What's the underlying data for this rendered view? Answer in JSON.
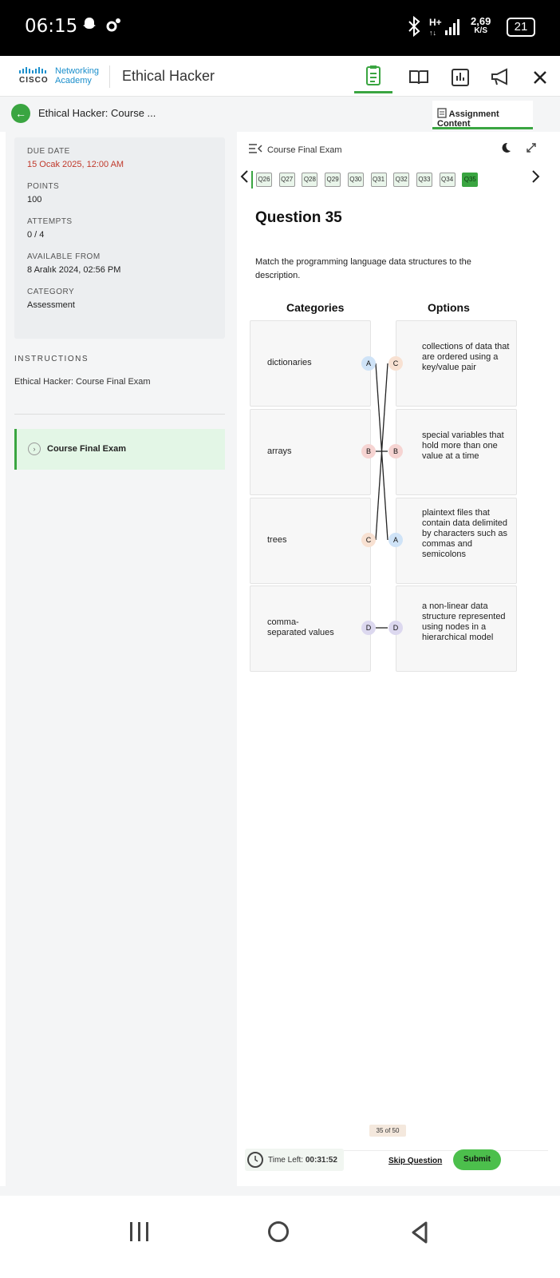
{
  "status_bar": {
    "time": "06:15",
    "speed_value": "2,69",
    "speed_unit": "K/S",
    "battery": "21",
    "icons": [
      "snapchat-ghost-icon",
      "settings-icon",
      "bluetooth-icon",
      "signal-icon",
      "battery-icon"
    ]
  },
  "header": {
    "logo_networking": "Networking",
    "logo_academy": "Academy",
    "logo_cisco": "CISCO",
    "app_title": "Ethical Hacker",
    "icons": [
      "assignment-icon",
      "book-icon",
      "gradebook-icon",
      "megaphone-icon",
      "close-icon"
    ]
  },
  "course_bar": {
    "title": "Ethical Hacker: Course ...",
    "assignment_tab": "Assignment Content"
  },
  "meta": {
    "due_date_label": "DUE DATE",
    "due_date_value": "15 Ocak 2025, 12:00 AM",
    "points_label": "POINTS",
    "points_value": "100",
    "attempts_label": "ATTEMPTS",
    "attempts_value": "0 / 4",
    "available_label": "AVAILABLE FROM",
    "available_value": "8 Aralık 2024, 02:56 PM",
    "category_label": "CATEGORY",
    "category_value": "Assessment"
  },
  "instructions": {
    "label": "INSTRUCTIONS",
    "text": "Ethical Hacker: Course Final Exam"
  },
  "module": {
    "label": "Course Final Exam"
  },
  "exam": {
    "header_title": "Course Final Exam",
    "question_nav": [
      "Q26",
      "Q27",
      "Q28",
      "Q29",
      "Q30",
      "Q31",
      "Q32",
      "Q33",
      "Q34",
      "Q35"
    ],
    "current_question": "Q35",
    "question_title": "Question 35",
    "question_text": "Match the programming language data structures to the description.",
    "categories_heading": "Categories",
    "options_heading": "Options",
    "categories": [
      {
        "label": "dictionaries",
        "badge": "A"
      },
      {
        "label": "arrays",
        "badge": "B"
      },
      {
        "label": "trees",
        "badge": "C"
      },
      {
        "label": "comma-\nseparated values",
        "badge": "D"
      }
    ],
    "options": [
      {
        "label": "collections of data that are ordered using a key/value pair",
        "badge": "C"
      },
      {
        "label": "special variables that hold more than one value at a time",
        "badge": "B"
      },
      {
        "label": "plaintext files that contain data delimited by characters such as commas and semicolons",
        "badge": "A"
      },
      {
        "label": "a non-linear data structure represented using nodes in a hierarchical model",
        "badge": "D"
      }
    ],
    "progress": "35 of 50",
    "timer_label": "Time Left:",
    "timer_value": "00:31:52",
    "skip_label": "Skip Question",
    "submit_label": "Submit"
  },
  "colors": {
    "accent": "#3aa541",
    "due_date": "#c0392b",
    "badge_a": "#cfe3f7",
    "badge_b": "#f6d4d2",
    "badge_c": "#f8e1d2",
    "badge_d": "#dcd8ef"
  }
}
